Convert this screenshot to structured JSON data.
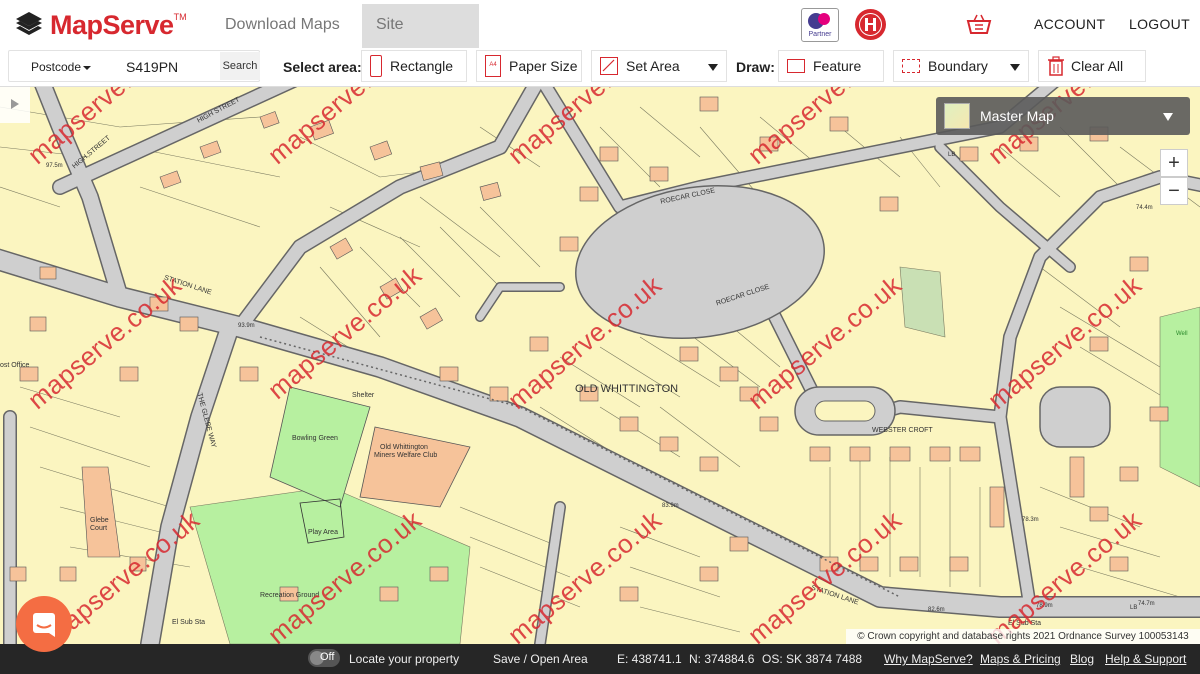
{
  "app": {
    "brand": "MapServe",
    "trademark": "TM"
  },
  "nav": {
    "tabs": [
      {
        "label": "Download Maps"
      },
      {
        "label": "Site Analyser"
      }
    ],
    "account": "ACCOUNT",
    "logout": "LOGOUT",
    "partner_badge": "Partner"
  },
  "toolbar": {
    "search_type": "Postcode",
    "search_value": "S419PN",
    "search_button": "Search",
    "select_area_label": "Select area:",
    "rectangle": "Rectangle",
    "paper_size": "Paper Size",
    "paper_icon_text": "A4",
    "set_area": "Set Area",
    "draw_label": "Draw:",
    "feature": "Feature",
    "boundary": "Boundary",
    "clear_all": "Clear All"
  },
  "map": {
    "layer": "Master Map",
    "zoom_in": "+",
    "zoom_out": "−",
    "watermark": "mapserve.co.uk",
    "labels": {
      "old_whittington": "OLD WHITTINGTON",
      "bowling_green": "Bowling Green",
      "club": "Old Whittington",
      "club2": "Miners Welfare Club",
      "station_lane": "STATION LANE",
      "station_lane2": "STATION LANE",
      "high_street": "HIGH STREET",
      "high_street2": "HIGH STREET",
      "roecar_close": "ROECAR CLOSE",
      "roecar_close2": "ROECAR CLOSE",
      "webster_croft": "WEBSTER CROFT",
      "the_glebe_way": "THE GLEBE WAY",
      "play_area": "Play Area",
      "recreation_ground": "Recreation Ground",
      "glebe_court": "Glebe",
      "glebe_court2": "Court",
      "shelter": "Shelter",
      "post_office": "ost Office",
      "sub_sta": "El Sub Sta",
      "sub_sta2": "El Sub Sta",
      "spot1": "97.5m",
      "spot2": "93.9m",
      "spot3": "83.9m",
      "spot4": "82.6m",
      "spot5": "78.9m",
      "spot6": "78.3m",
      "spot7": "74.7m",
      "spot8": "74.4m",
      "lb": "LB",
      "lb2": "LB",
      "well": "Well"
    },
    "copyright": "© Crown copyright and database rights 2021 Ordnance Survey 100053143"
  },
  "status": {
    "toggle": "Off",
    "locate": "Locate your property",
    "save_open": "Save / Open Area",
    "easting": "E: 438741.1",
    "northing": "N: 374884.6",
    "os_ref": "OS: SK 3874 7488",
    "links": [
      "Why MapServe?",
      "Maps & Pricing",
      "Blog",
      "Help & Support"
    ]
  },
  "colors": {
    "brand": "#d7282f",
    "map_bg": "#fbf5c0",
    "road": "#cfcfcf",
    "building": "#f6c39a",
    "grass": "#b7f0a0"
  }
}
